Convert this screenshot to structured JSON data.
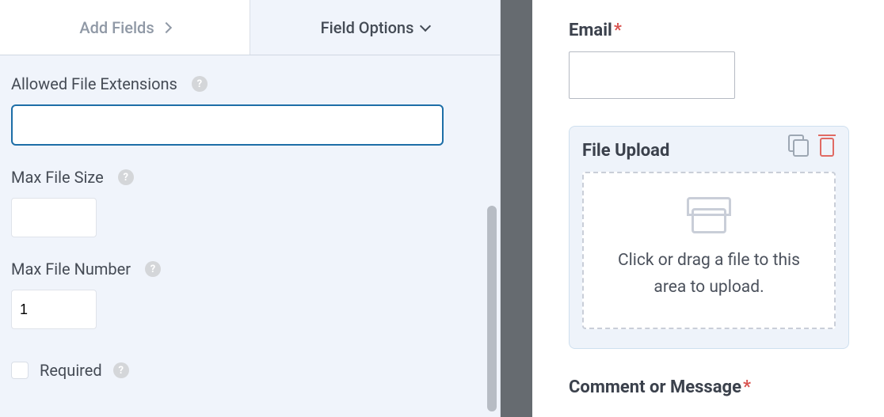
{
  "tabs": {
    "add_fields": "Add Fields",
    "field_options": "Field Options"
  },
  "options": {
    "allowed_ext_label": "Allowed File Extensions",
    "allowed_ext_value": "",
    "max_size_label": "Max File Size",
    "max_size_value": "",
    "max_number_label": "Max File Number",
    "max_number_value": "1",
    "required_label": "Required"
  },
  "preview": {
    "email_label": "Email",
    "file_upload_label": "File Upload",
    "dropzone_text": "Click or drag a file to this area to upload.",
    "comment_label": "Comment or Message"
  },
  "help_glyph": "?"
}
